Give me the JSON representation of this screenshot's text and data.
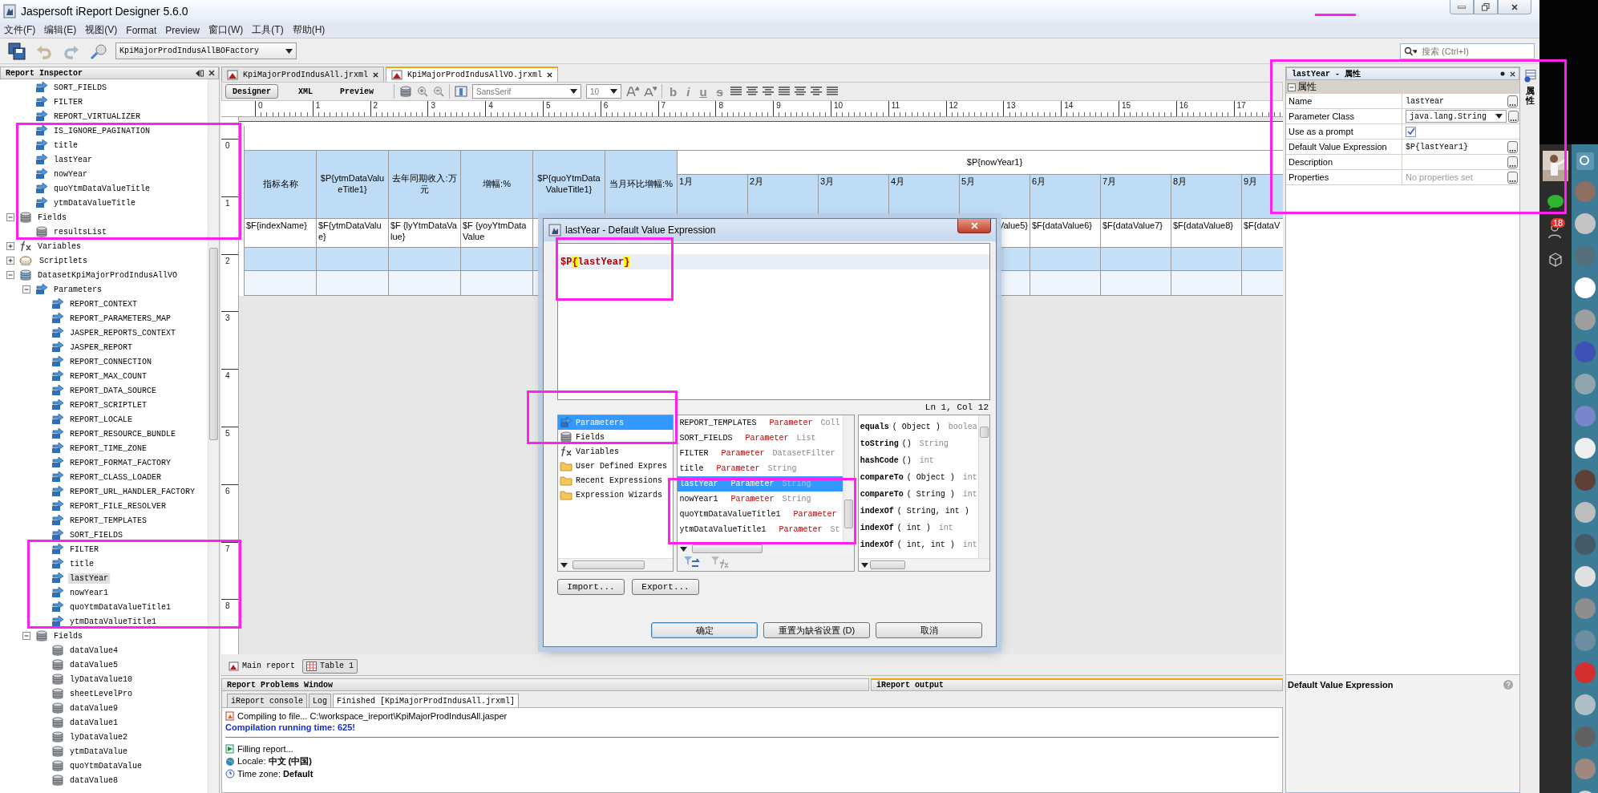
{
  "window": {
    "title": "Jaspersoft iReport Designer 5.6.0"
  },
  "menu": [
    "文件(F)",
    "编辑(E)",
    "视图(V)",
    "Format",
    "Preview",
    "窗口(W)",
    "工具(T)",
    "帮助(H)"
  ],
  "toolbar": {
    "datasource": "KpiMajorProdIndusAllBOFactory",
    "search": {
      "placeholder": "搜索 (Ctrl+I)"
    }
  },
  "inspector": {
    "title": "Report Inspector",
    "tree": [
      {
        "children": [
          {
            "label": "SORT_FIELDS",
            "kind": "parameter",
            "selected": false
          },
          {
            "label": "FILTER",
            "kind": "parameter",
            "selected": false
          },
          {
            "label": "REPORT_VIRTUALIZER",
            "kind": "parameter",
            "selected": false
          },
          {
            "label": "IS_IGNORE_PAGINATION",
            "kind": "parameter",
            "selected": false
          },
          {
            "label": "title",
            "kind": "parameter",
            "selected": false
          },
          {
            "label": "lastYear",
            "kind": "parameter",
            "selected": false
          },
          {
            "label": "nowYear",
            "kind": "parameter",
            "selected": false
          },
          {
            "label": "quoYtmDataValueTitle",
            "kind": "parameter",
            "selected": false
          },
          {
            "label": "ytmDataValueTitle",
            "kind": "parameter",
            "selected": false
          }
        ]
      },
      {
        "label": "Fields",
        "kind": "fields",
        "expanded": true,
        "selected": false,
        "children": [
          {
            "label": "resultsList",
            "kind": "field",
            "selected": false
          }
        ]
      },
      {
        "label": "Variables",
        "kind": "variables",
        "expanded": false,
        "selected": false
      },
      {
        "label": "Scriptlets",
        "kind": "scriptlets",
        "expanded": false,
        "selected": false
      },
      {
        "label": "DatasetKpiMajorProdIndusAllVO",
        "kind": "dataset",
        "expanded": true,
        "selected": false,
        "children": [
          {
            "label": "Parameters",
            "kind": "parameters",
            "expanded": true,
            "selected": false,
            "children": [
              {
                "label": "REPORT_CONTEXT",
                "kind": "parameter",
                "selected": false
              },
              {
                "label": "REPORT_PARAMETERS_MAP",
                "kind": "parameter",
                "selected": false
              },
              {
                "label": "JASPER_REPORTS_CONTEXT",
                "kind": "parameter",
                "selected": false
              },
              {
                "label": "JASPER_REPORT",
                "kind": "parameter",
                "selected": false
              },
              {
                "label": "REPORT_CONNECTION",
                "kind": "parameter",
                "selected": false
              },
              {
                "label": "REPORT_MAX_COUNT",
                "kind": "parameter",
                "selected": false
              },
              {
                "label": "REPORT_DATA_SOURCE",
                "kind": "parameter",
                "selected": false
              },
              {
                "label": "REPORT_SCRIPTLET",
                "kind": "parameter",
                "selected": false
              },
              {
                "label": "REPORT_LOCALE",
                "kind": "parameter",
                "selected": false
              },
              {
                "label": "REPORT_RESOURCE_BUNDLE",
                "kind": "parameter",
                "selected": false
              },
              {
                "label": "REPORT_TIME_ZONE",
                "kind": "parameter",
                "selected": false
              },
              {
                "label": "REPORT_FORMAT_FACTORY",
                "kind": "parameter",
                "selected": false
              },
              {
                "label": "REPORT_CLASS_LOADER",
                "kind": "parameter",
                "selected": false
              },
              {
                "label": "REPORT_URL_HANDLER_FACTORY",
                "kind": "parameter",
                "selected": false
              },
              {
                "label": "REPORT_FILE_RESOLVER",
                "kind": "parameter",
                "selected": false
              },
              {
                "label": "REPORT_TEMPLATES",
                "kind": "parameter",
                "selected": false
              },
              {
                "label": "SORT_FIELDS",
                "kind": "parameter",
                "selected": false
              },
              {
                "label": "FILTER",
                "kind": "parameter",
                "selected": false
              },
              {
                "label": "title",
                "kind": "parameter",
                "selected": false
              },
              {
                "label": "lastYear",
                "kind": "parameter",
                "selected": true
              },
              {
                "label": "nowYear1",
                "kind": "parameter",
                "selected": false
              },
              {
                "label": "quoYtmDataValueTitle1",
                "kind": "parameter",
                "selected": false
              },
              {
                "label": "ytmDataValueTitle1",
                "kind": "parameter",
                "selected": false
              }
            ]
          },
          {
            "label": "Fields",
            "kind": "fields",
            "expanded": true,
            "selected": false,
            "children": [
              {
                "label": "dataValue4",
                "kind": "field",
                "selected": false
              },
              {
                "label": "dataValue5",
                "kind": "field",
                "selected": false
              },
              {
                "label": "lyDataValue10",
                "kind": "field",
                "selected": false
              },
              {
                "label": "sheetLevelPro",
                "kind": "field",
                "selected": false
              },
              {
                "label": "dataValue9",
                "kind": "field",
                "selected": false
              },
              {
                "label": "dataValue1",
                "kind": "field",
                "selected": false
              },
              {
                "label": "lyDataValue2",
                "kind": "field",
                "selected": false
              },
              {
                "label": "ytmDataValue",
                "kind": "field",
                "selected": false
              },
              {
                "label": "quoYtmDataValue",
                "kind": "field",
                "selected": false
              },
              {
                "label": "dataValue8",
                "kind": "field",
                "selected": false
              }
            ]
          }
        ]
      }
    ]
  },
  "editor_tabs": [
    {
      "label": "KpiMajorProdIndusAll.jrxml",
      "selected": false
    },
    {
      "label": "KpiMajorProdIndusAllVO.jrxml",
      "selected": true
    }
  ],
  "view_modes": [
    {
      "label": "Designer",
      "selected": true
    },
    {
      "label": "XML",
      "selected": false
    },
    {
      "label": "Preview",
      "selected": false
    }
  ],
  "font_name": "SansSerif",
  "font_size": "10",
  "style_buttons": [
    "b",
    "i",
    "u",
    "s"
  ],
  "ruler": {
    "horizontal": [
      "0",
      "1",
      "2",
      "3",
      "4",
      "5",
      "6",
      "7",
      "8",
      "9",
      "10",
      "11",
      "12",
      "13",
      "14",
      "15",
      "16",
      "17"
    ],
    "vertical": [
      "0",
      "1",
      "2",
      "3",
      "4",
      "5",
      "6",
      "7",
      "8"
    ]
  },
  "table": {
    "columns": [
      {
        "header": "指标名称",
        "detail": "$F{indexName}"
      },
      {
        "header": "$P{ytmDataValueTitle1}",
        "detail": "$F{ytmDataValue}"
      },
      {
        "header": "去年同期收入:万元",
        "detail": "$F {lyYtmDataValue}"
      },
      {
        "header": "增幅:%",
        "detail": "$F {yoyYtmDataValue"
      },
      {
        "header": "$P{quoYtmDataValueTitle1}"
      },
      {
        "header": "当月环比增幅:%"
      }
    ],
    "group_header": "$P{nowYear1}",
    "months": [
      {
        "label": "1月"
      },
      {
        "label": "2月"
      },
      {
        "label": "3月"
      },
      {
        "label": "4月"
      },
      {
        "label": "5月",
        "detail": "Value5}"
      },
      {
        "label": "6月",
        "detail": "$F{dataValue6}"
      },
      {
        "label": "7月",
        "detail": "$F{dataValue7}"
      },
      {
        "label": "8月",
        "detail": "$F{dataValue8}"
      },
      {
        "label": "9月",
        "detail": "$F{dataV"
      }
    ]
  },
  "report_tabs": [
    {
      "label": "Main report",
      "selected": false
    },
    {
      "label": "Table 1",
      "selected": true
    }
  ],
  "dialog": {
    "title": "lastYear - Default Value Expression",
    "expression": "$P{lastYear}",
    "cursor": "Ln 1, Col 12",
    "categories": [
      {
        "label": "Parameters",
        "kind": "parameters",
        "selected": true
      },
      {
        "label": "Fields",
        "kind": "fields",
        "selected": false
      },
      {
        "label": "Variables",
        "kind": "variables",
        "selected": false
      },
      {
        "label": "User Defined Expres",
        "kind": "folder",
        "selected": false
      },
      {
        "label": "Recent Expressions",
        "kind": "folder",
        "selected": false
      },
      {
        "label": "Expression Wizards",
        "kind": "folder",
        "selected": false
      }
    ],
    "objects": [
      {
        "name": "REPORT_TEMPLATES",
        "role": "Parameter",
        "type": "Coll",
        "selected": false
      },
      {
        "name": "SORT_FIELDS",
        "role": "Parameter",
        "type": "List",
        "selected": false
      },
      {
        "name": "FILTER",
        "role": "Parameter",
        "type": "DatasetFilter",
        "selected": false
      },
      {
        "name": "title",
        "role": "Parameter",
        "type": "String",
        "selected": false
      },
      {
        "name": "lastYear",
        "role": "Parameter",
        "type": "String",
        "selected": true
      },
      {
        "name": "nowYear1",
        "role": "Parameter",
        "type": "String",
        "selected": false
      },
      {
        "name": "quoYtmDataValueTitle1",
        "role": "Parameter",
        "selected": false
      },
      {
        "name": "ytmDataValueTitle1",
        "role": "Parameter",
        "type": "St",
        "selected": false
      }
    ],
    "methods": [
      {
        "name": "equals",
        "args": "( Object )",
        "returns": "boolea"
      },
      {
        "name": "toString",
        "args": "()",
        "returns": "String"
      },
      {
        "name": "hashCode",
        "args": "()",
        "returns": "int"
      },
      {
        "name": "compareTo",
        "args": "( Object )",
        "returns": "int"
      },
      {
        "name": "compareTo",
        "args": "( String )",
        "returns": "int"
      },
      {
        "name": "indexOf",
        "args": "( String, int )"
      },
      {
        "name": "indexOf",
        "args": "( int )",
        "returns": "int"
      },
      {
        "name": "indexOf",
        "args": "( int, int )",
        "returns": "int"
      }
    ],
    "tools": [
      "Import...",
      "Export..."
    ],
    "actions": [
      {
        "label": "确定",
        "default": true
      },
      {
        "label": "重置为缺省设置 (D)",
        "default": false
      },
      {
        "label": "取消",
        "default": false
      }
    ]
  },
  "properties": {
    "title": "lastYear - 属性",
    "section": {
      "label": "属性",
      "expanded": true
    },
    "rows": [
      {
        "label": "Name",
        "kind": "text",
        "value": "lastYear"
      },
      {
        "label": "Parameter Class",
        "kind": "select",
        "value": "java.lang.String"
      },
      {
        "label": "Use as a prompt",
        "kind": "checkbox",
        "checked": true
      },
      {
        "label": "Default Value Expression",
        "kind": "text",
        "value": "$P{lastYear1}"
      },
      {
        "label": "Description",
        "kind": "text"
      },
      {
        "label": "Properties",
        "kind": "hint",
        "value": "No properties set"
      }
    ],
    "help_title": "Default Value Expression",
    "side_tab": "属性"
  },
  "bottom": {
    "panels": [
      {
        "label": "Report Problems Window",
        "selected": false
      },
      {
        "label": "iReport output",
        "selected": true
      }
    ],
    "tabs": [
      {
        "label": "iReport console",
        "selected": false
      },
      {
        "label": "Log",
        "selected": false
      },
      {
        "label": "Finished [KpiMajorProdIndusAll.jrxml]",
        "selected": true
      }
    ],
    "console": [
      {
        "kind": "compile",
        "text": "Compiling to file... C:\\workspace_ireport\\KpiMajorProdIndusAll.jasper"
      },
      {
        "kind": "timing",
        "text": "Compilation running time: 625!"
      },
      {
        "kind": "fill",
        "text": "Filling report..."
      },
      {
        "kind": "locale",
        "text": "Locale: **中文 (中国)**"
      },
      {
        "kind": "timezone",
        "text": "Time zone: **Default**"
      }
    ]
  },
  "desktop": {
    "badge": "18"
  }
}
